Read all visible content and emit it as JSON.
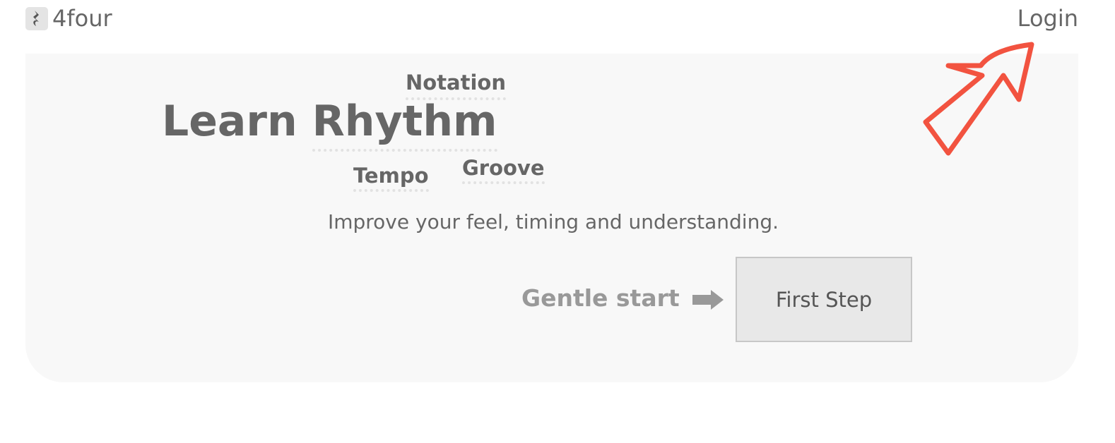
{
  "header": {
    "brand_name": "4four",
    "brand_icon": "quarter-rest-icon",
    "login_label": "Login"
  },
  "hero": {
    "title_prefix": "Learn",
    "title_highlight": "Rhythm",
    "floating_words": [
      "Notation",
      "Tempo",
      "Groove"
    ],
    "subtitle": "Improve your feel, timing and understanding.",
    "cta_lead": "Gentle start",
    "cta_lead_icon": "arrow-right-icon",
    "cta_button_label": "First Step"
  },
  "annotation": {
    "icon": "hand-drawn-arrow-icon",
    "color": "#f25340"
  },
  "colors": {
    "text": "#666666",
    "hero_background": "#f8f8f8",
    "button_background": "#e8e8e8",
    "muted_text": "#999999"
  }
}
